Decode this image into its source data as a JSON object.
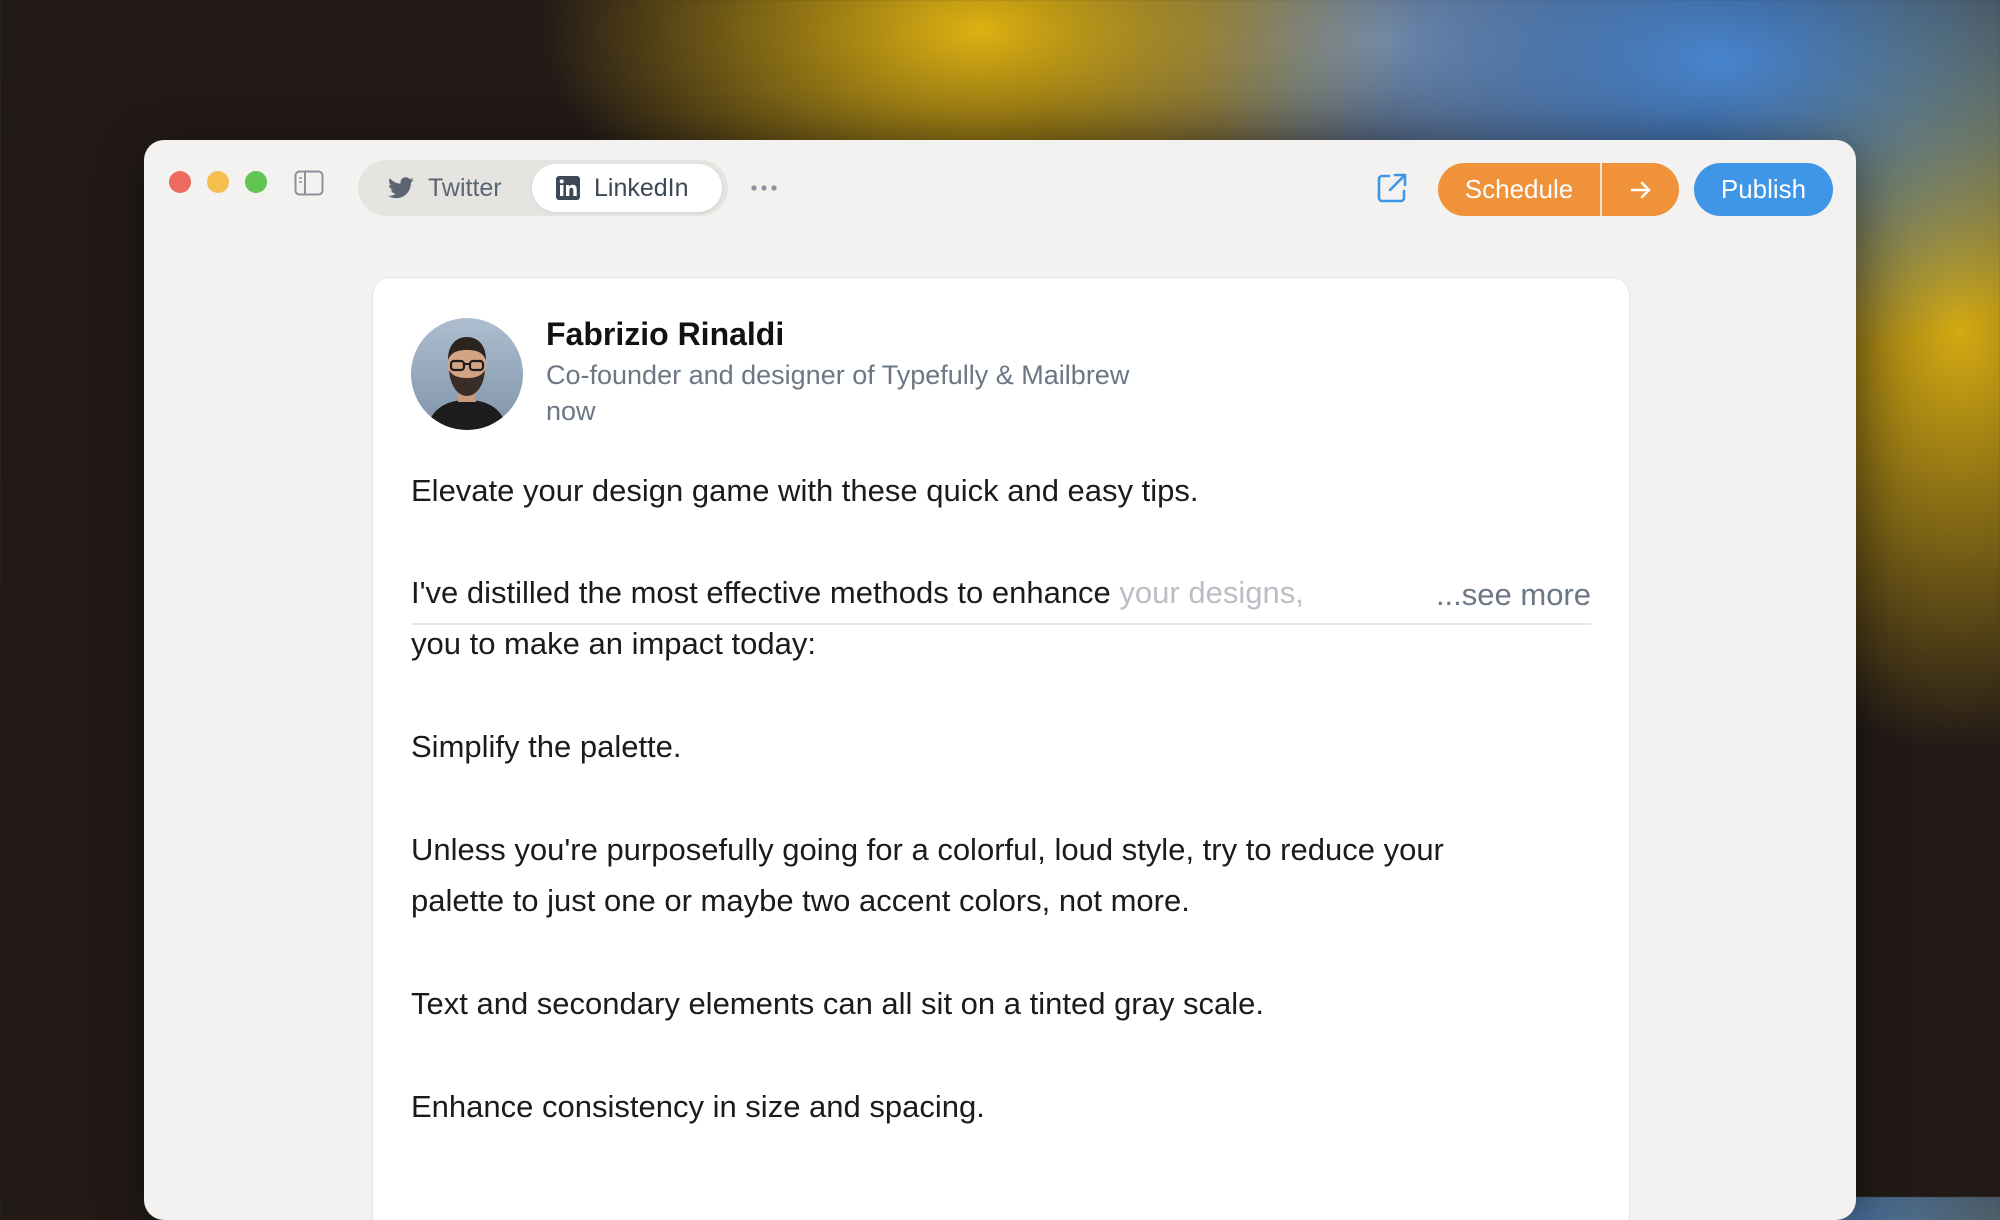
{
  "toolbar": {
    "tabs": [
      {
        "label": "Twitter",
        "icon": "twitter-icon",
        "active": false
      },
      {
        "label": "LinkedIn",
        "icon": "linkedin-icon",
        "active": true
      }
    ],
    "more_icon": "more-horizontal-icon",
    "open_external_icon": "external-link-icon",
    "schedule_label": "Schedule",
    "schedule_arrow_icon": "arrow-right-icon",
    "publish_label": "Publish"
  },
  "colors": {
    "schedule": "#f0923a",
    "publish": "#3f95e6",
    "muted_text": "#6c7785",
    "window_bg": "#f3f2f0"
  },
  "post": {
    "author_name": "Fabrizio Rinaldi",
    "author_headline": "Co-founder and designer of Typefully & Mailbrew",
    "time": "now",
    "line1": "Elevate your design game with these quick and easy tips.",
    "line2_visible": "I've distilled the most effective methods to enhance ",
    "line2_faded": "your designs,",
    "see_more": "...see more",
    "line3": "you to make an impact today:",
    "line4": "Simplify the palette.",
    "line5a": "Unless you're purposefully going for a colorful, loud style, try to reduce your",
    "line5b": "palette to just one or maybe two accent colors, not more.",
    "line6": "Text and secondary elements can all sit on a tinted gray scale.",
    "line7": "Enhance consistency in size and spacing."
  }
}
